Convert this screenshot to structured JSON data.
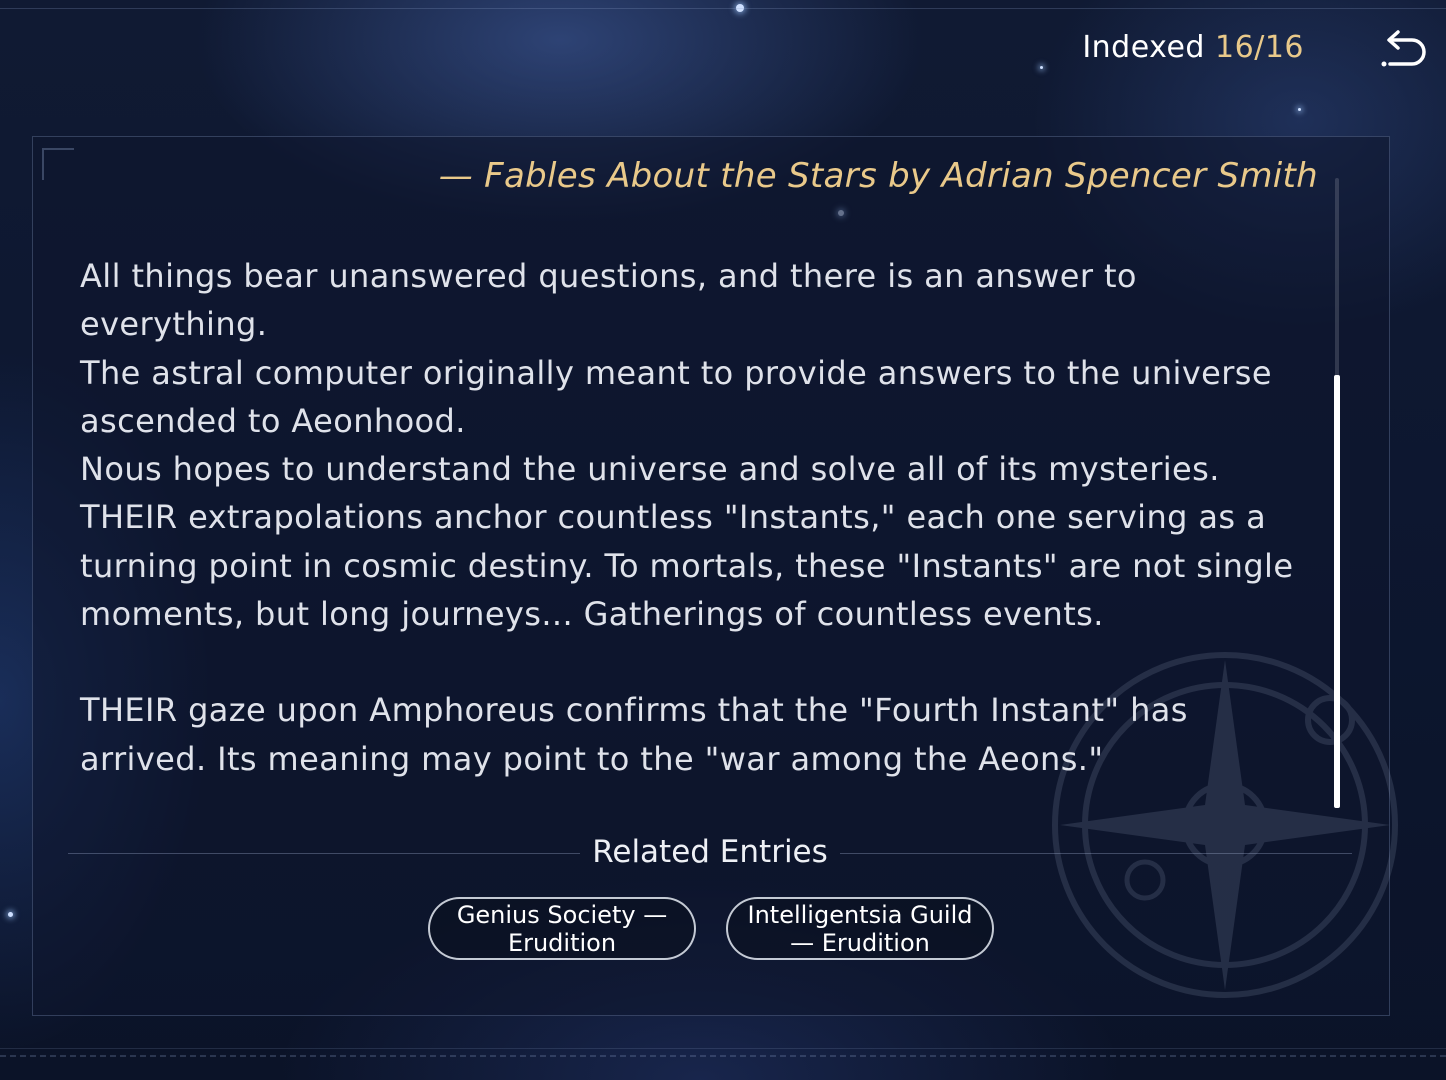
{
  "header": {
    "indexed_label": "Indexed",
    "indexed_count": "16/16"
  },
  "back_button": {
    "icon": "return-arrow-icon"
  },
  "entry": {
    "quote": "— Fables About the Stars by Adrian Spencer Smith",
    "paragraphs": [
      "All things bear unanswered questions, and there is an answer to everything.",
      "The astral computer originally meant to provide answers to the universe ascended to Aeonhood.",
      "Nous hopes to understand the universe and solve all of its mysteries. THEIR extrapolations anchor countless \"Instants,\" each one serving as a turning point in cosmic destiny. To mortals, these \"Instants\" are not single moments, but long journeys... Gatherings of countless events.",
      "THEIR gaze upon Amphoreus confirms that the \"Fourth Instant\" has arrived. Its meaning may point to the \"war among the Aeons.\""
    ]
  },
  "related": {
    "title": "Related Entries",
    "entries": [
      {
        "label": "Genius Society — Erudition"
      },
      {
        "label": "Intelligentsia Guild — Erudition"
      }
    ]
  },
  "colors": {
    "accent_gold": "#e9c98a",
    "text": "#dfe2ea"
  }
}
